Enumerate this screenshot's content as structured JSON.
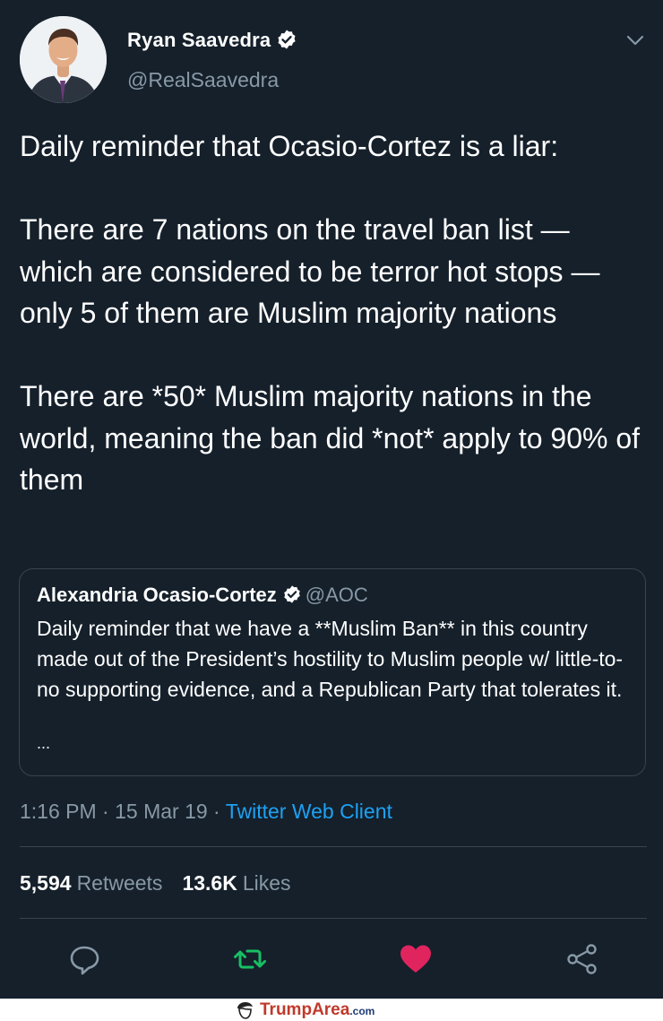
{
  "author": {
    "name": "Ryan Saavedra",
    "handle": "@RealSaavedra",
    "verified_icon": "verified-badge-icon"
  },
  "tweet": {
    "text": "Daily reminder that Ocasio-Cortez is a liar:\n\nThere are 7 nations on the travel ban list — which are considered to be terror hot stops — only 5 of them are Muslim majority nations\n\nThere are *50* Muslim majority nations in the world, meaning the ban did *not* apply to 90% of them"
  },
  "quote": {
    "name": "Alexandria Ocasio-Cortez",
    "handle": "@AOC",
    "text": "Daily reminder that we have a **Muslim Ban** in this country made out of the President’s hostility to Muslim people w/ little-to-no supporting evidence, and a Republican Party that tolerates it.",
    "more": "..."
  },
  "meta": {
    "time": "1:16 PM",
    "sep1": " · ",
    "date": "15 Mar 19",
    "sep2": " · ",
    "client": "Twitter Web Client"
  },
  "stats": {
    "retweets_count": "5,594",
    "retweets_label": "Retweets",
    "likes_count": "13.6K",
    "likes_label": "Likes"
  },
  "actions": {
    "reply": "reply-icon",
    "retweet": "retweet-icon",
    "like": "heart-icon",
    "share": "share-icon"
  },
  "colors": {
    "background": "#15202b",
    "muted": "#8899a6",
    "link": "#1da1f2",
    "retweet_green": "#17bf63",
    "like_red": "#e0245e",
    "border": "#38444d"
  },
  "watermark": {
    "brand_main": "Trump",
    "brand_area": "Area",
    "brand_tld": ".com"
  }
}
